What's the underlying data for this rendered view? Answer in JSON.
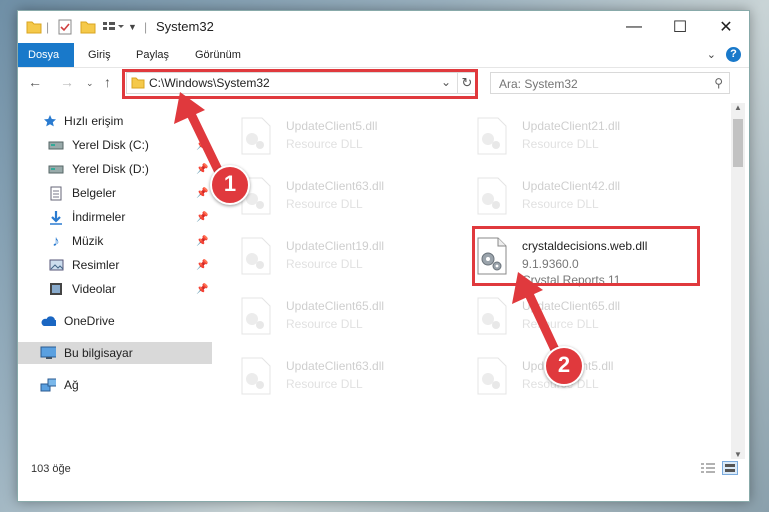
{
  "window": {
    "title": "System32"
  },
  "ribbon": {
    "tabs": [
      "Dosya",
      "Giriş",
      "Paylaş",
      "Görünüm"
    ],
    "help_label": "?"
  },
  "address": {
    "path": "C:\\Windows\\System32"
  },
  "search": {
    "placeholder": "Ara: System32"
  },
  "sidebar": {
    "items": [
      {
        "label": "Hızlı erişim",
        "icon": "star-icon"
      },
      {
        "label": "Yerel Disk (C:)",
        "icon": "drive-icon"
      },
      {
        "label": "Yerel Disk (D:)",
        "icon": "drive-icon"
      },
      {
        "label": "Belgeler",
        "icon": "documents-icon"
      },
      {
        "label": "İndirmeler",
        "icon": "download-icon"
      },
      {
        "label": "Müzik",
        "icon": "music-icon"
      },
      {
        "label": "Resimler",
        "icon": "pictures-icon"
      },
      {
        "label": "Videolar",
        "icon": "videos-icon"
      },
      {
        "label": "OneDrive",
        "icon": "cloud-icon"
      },
      {
        "label": "Bu bilgisayar",
        "icon": "computer-icon"
      },
      {
        "label": "Ağ",
        "icon": "network-icon"
      }
    ]
  },
  "files": [
    {
      "name": "UpdateClient5.dll",
      "type": "Resource DLL"
    },
    {
      "name": "UpdateClient21.dll",
      "type": "Resource DLL"
    },
    {
      "name": "UpdateClient63.dll",
      "type": "Resource DLL"
    },
    {
      "name": "UpdateClient42.dll",
      "type": "Resource DLL"
    },
    {
      "name": "UpdateClient19.dll",
      "type": "Resource DLL"
    },
    {
      "name": "crystaldecisions.web.dll",
      "version": "9.1.9360.0",
      "product": "Crystal Reports 11"
    },
    {
      "name": "UpdateClient65.dll",
      "type": "Resource DLL"
    },
    {
      "name": "UpdateClient65.dll",
      "type": "Resource DLL"
    },
    {
      "name": "UpdateClient63.dll",
      "type": "Resource DLL"
    },
    {
      "name": "UpdateClient5.dll",
      "type": "Resource DLL"
    }
  ],
  "status": {
    "item_count": "103 öğe"
  },
  "annotations": {
    "step1": "1",
    "step2": "2"
  },
  "colors": {
    "accent": "#1979ca",
    "highlight": "#e0393d"
  }
}
